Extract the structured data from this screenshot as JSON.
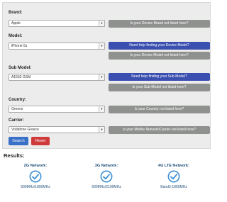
{
  "form": {
    "brand": {
      "label": "Brand:",
      "value": "Apple",
      "button": "Is your Device Brand not listed here?"
    },
    "model": {
      "label": "Model:",
      "value": "iPhone 5s",
      "help_button": "Need help finding your Device Model?",
      "button": "Is your Device Model not listed here?"
    },
    "sub_model": {
      "label": "Sub Model:",
      "value": "A1533 GSM",
      "help_button": "Need help finding your Sub-Model?",
      "button": "Is your Sub-Model not listed here?"
    },
    "country": {
      "label": "Country:",
      "value": "Greece",
      "button": "Is your Country not listed here?"
    },
    "carrier": {
      "label": "Carrier:",
      "value": "Vodafone Greece",
      "button": "Is your Mobile Network/Carrier not listed here?"
    },
    "search_label": "Search",
    "reset_label": "Reset"
  },
  "results": {
    "title": "Results:",
    "networks": [
      {
        "title": "2G Network:",
        "value": "900MHz/1800MHz"
      },
      {
        "title": "3G Network:",
        "value": "900MHz/2100MHz"
      },
      {
        "title": "4G LTE Network:",
        "value": "Band3-1800MHz"
      }
    ]
  },
  "colors": {
    "gray_button": "#8e918e",
    "blue_button": "#3b4fb0",
    "search_button": "#3a70c8",
    "reset_button": "#cf3a3a",
    "check_icon": "#3b8fd6"
  },
  "icons": {
    "dropdown": "chevron-down-icon",
    "network_status": "check-circle-icon"
  }
}
